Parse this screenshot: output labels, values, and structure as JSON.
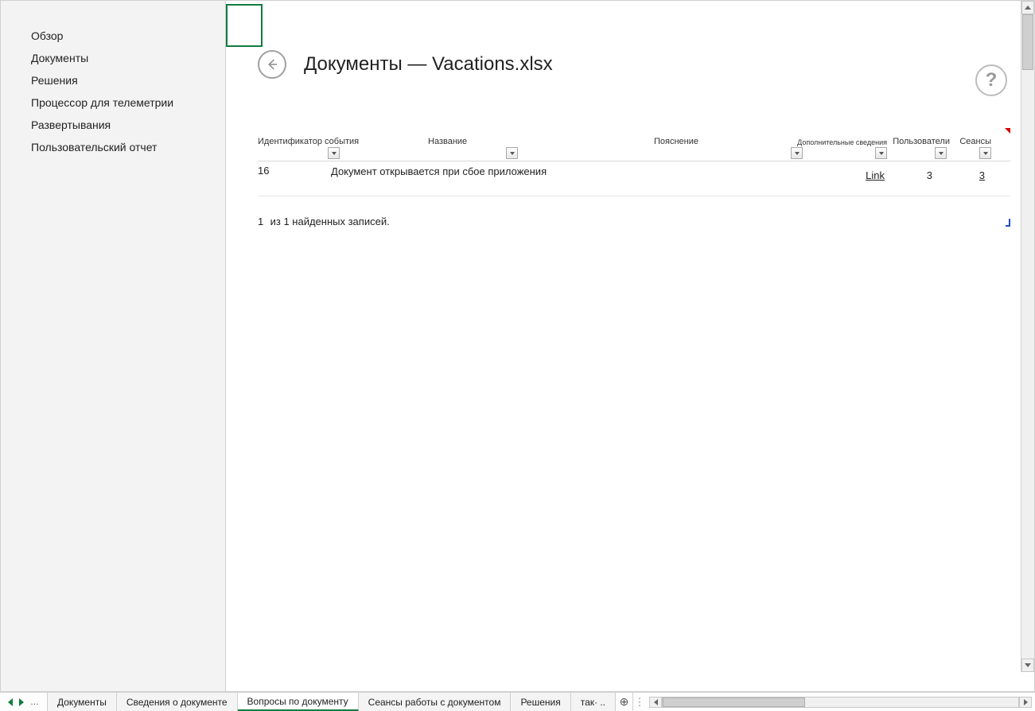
{
  "sidebar": {
    "items": [
      {
        "label": "Обзор"
      },
      {
        "label": "Документы"
      },
      {
        "label": "Решения"
      },
      {
        "label": "Процессор для телеметрии"
      },
      {
        "label": "Развертывания"
      },
      {
        "label": "Пользовательский отчет"
      }
    ]
  },
  "page": {
    "title": "Документы — Vacations.xlsx"
  },
  "table": {
    "headers": {
      "event_id": "Идентификатор события",
      "name": "Название",
      "description": "Пояснение",
      "info": "Дополнительные сведения",
      "users": "Пользователи",
      "sessions": "Сеансы"
    },
    "rows": [
      {
        "event_id": "16",
        "name": "Документ открывается при сбое приложения",
        "description": "",
        "info_link": "Link",
        "users": "3",
        "sessions": "3"
      }
    ],
    "footer": {
      "count": "1",
      "text": "из 1 найденных записей."
    }
  },
  "tabs": {
    "items": [
      {
        "label": "Документы",
        "active": false
      },
      {
        "label": "Сведения о документе",
        "active": false
      },
      {
        "label": "Вопросы по документу",
        "active": true
      },
      {
        "label": "Сеансы работы с документом",
        "active": false
      },
      {
        "label": "Решения",
        "active": false
      },
      {
        "label": "так· ..",
        "active": false
      }
    ],
    "ellipsis": "…",
    "add": "⊕"
  }
}
